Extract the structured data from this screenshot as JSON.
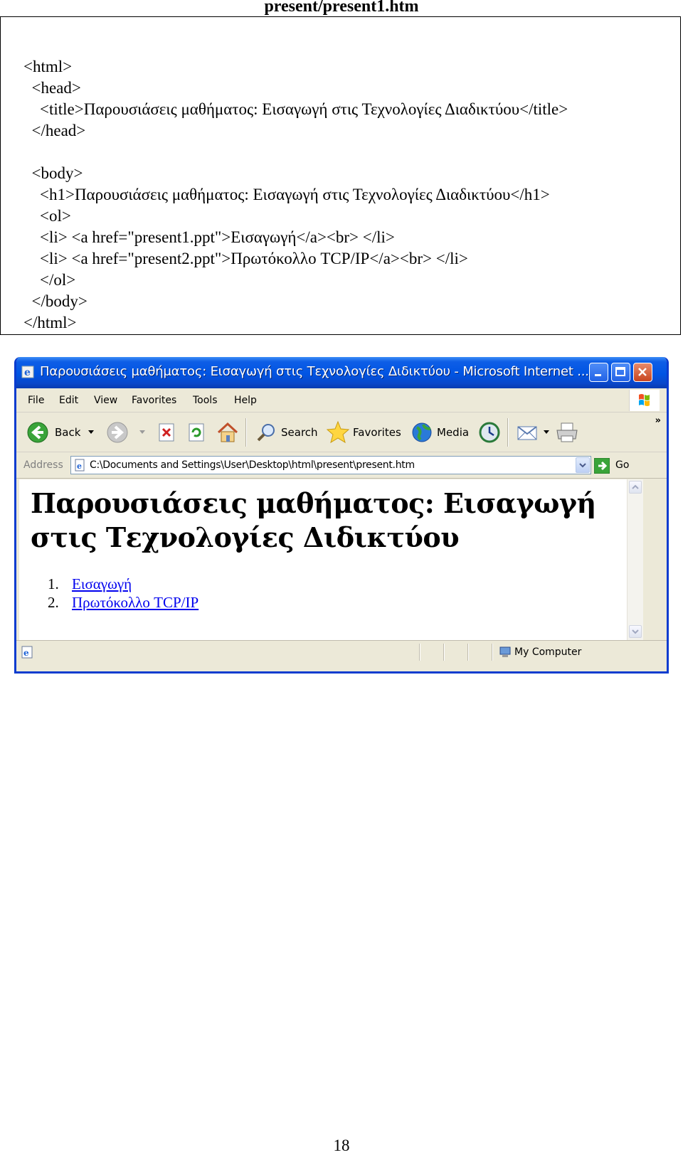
{
  "caption": "present/present1.htm",
  "code_lines": [
    "<html>",
    "  <head>",
    "    <title>Παρουσιάσεις μαθήματος: Εισαγωγή στις Τεχνολογίες Διαδικτύου</title>",
    "  </head>",
    "",
    "  <body>",
    "    <h1>Παρουσιάσεις μαθήματος: Εισαγωγή στις Τεχνολογίες Διαδικτύου</h1>",
    "    <ol>",
    "    <li> <a href=\"present1.ppt\">Εισαγωγή</a><br> </li>",
    "    <li> <a href=\"present2.ppt\">Πρωτόκολλο TCP/IP</a><br> </li>",
    "    </ol>",
    "  </body>",
    "</html>"
  ],
  "browser": {
    "window_title": "Παρουσιάσεις μαθήματος: Εισαγωγή στις Τεχνολογίες Διδικτύου - Microsoft Internet ...",
    "menu": [
      "File",
      "Edit",
      "View",
      "Favorites",
      "Tools",
      "Help"
    ],
    "toolbar": {
      "back": "Back",
      "search": "Search",
      "favorites": "Favorites",
      "media": "Media"
    },
    "address_label": "Address",
    "address_value": "C:\\Documents and Settings\\User\\Desktop\\html\\present\\present.htm",
    "go_label": "Go",
    "page": {
      "heading": "Παρουσιάσεις μαθήματος: Εισαγωγή στις Τεχνολογίες Διδικτύου",
      "list": [
        {
          "num": "1.",
          "text": "Εισαγωγή"
        },
        {
          "num": "2.",
          "text": "Πρωτόκολλο TCP/IP"
        }
      ]
    },
    "status_zone": "My Computer"
  },
  "page_number": "18",
  "colors": {
    "titlebar": "#0054e3",
    "link": "#0000ee",
    "chrome": "#ece9d8"
  }
}
